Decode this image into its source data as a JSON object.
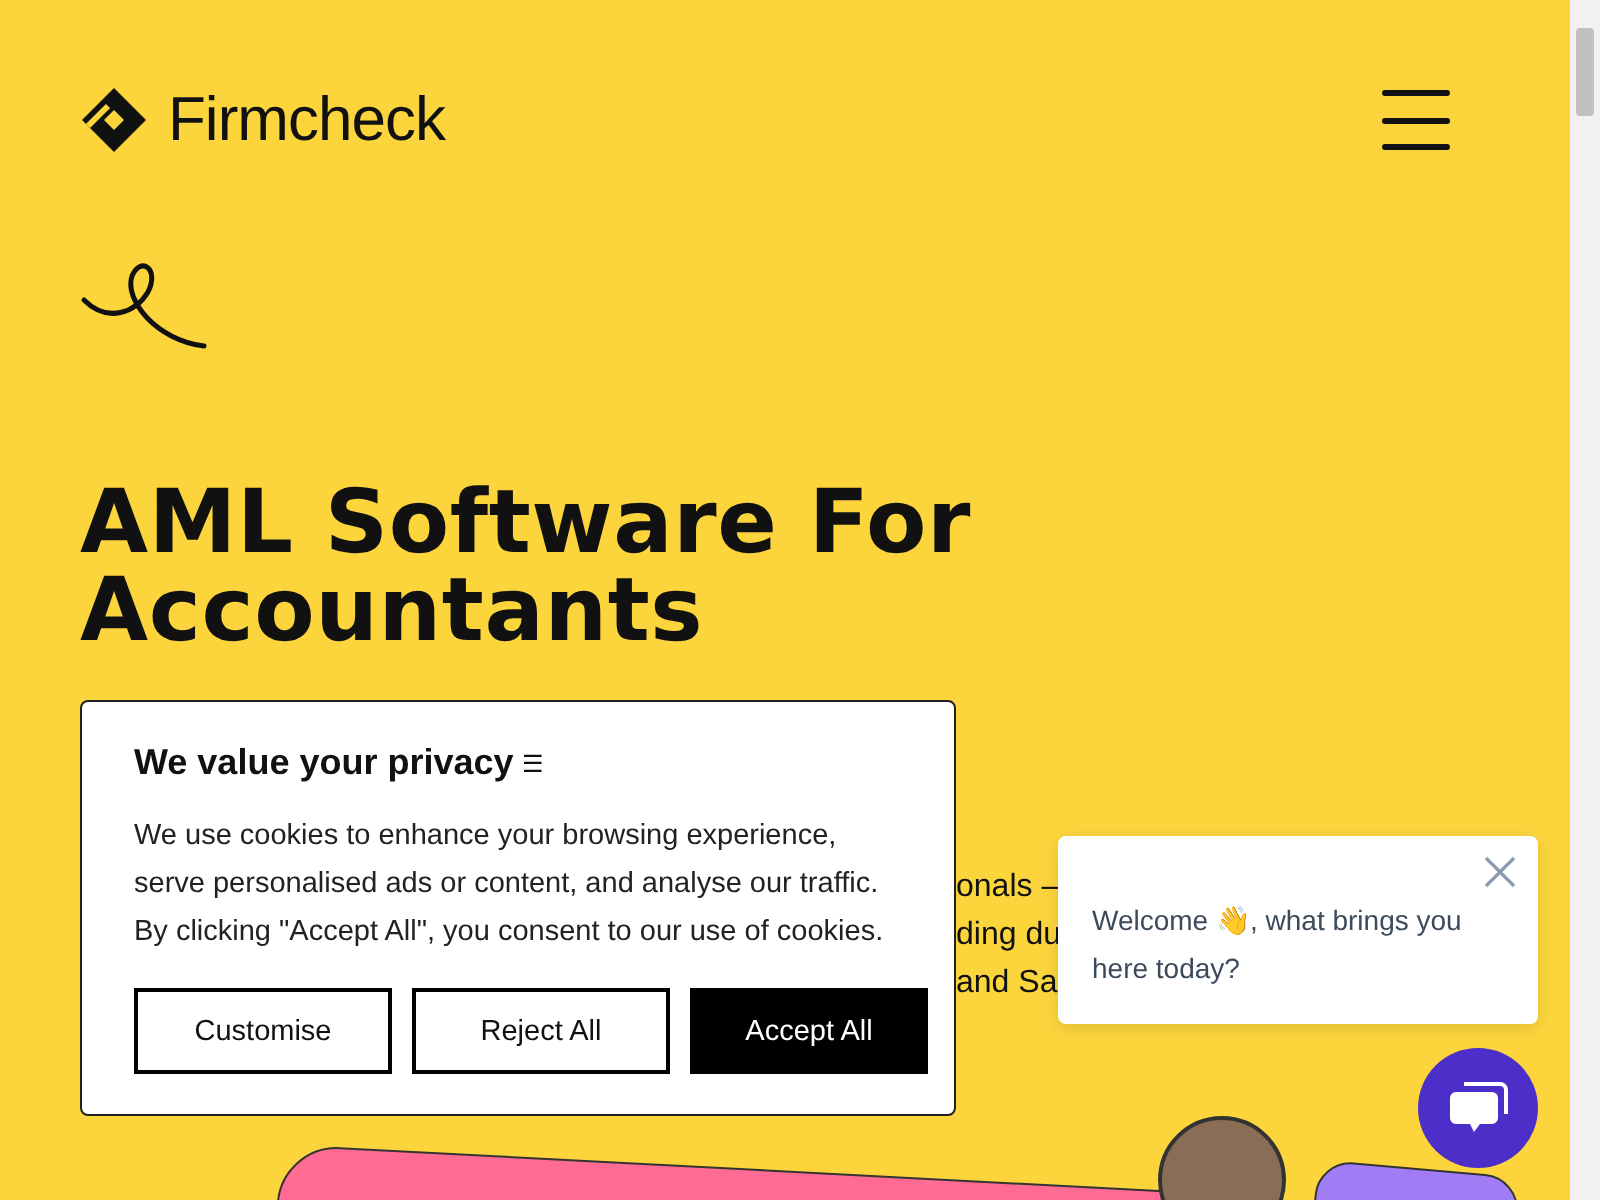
{
  "header": {
    "brand": "Firmcheck"
  },
  "hero": {
    "heading": "AML Software For Accountants",
    "text_lines": [
      "onals –",
      "ding du",
      "and Sa"
    ]
  },
  "cookie_banner": {
    "title": "We value your privacy",
    "title_glyph": "☰",
    "message": "We use cookies to enhance your browsing experience, serve personalised ads or content, and analyse our traffic. By clicking \"Accept All\", you consent to our use of cookies.",
    "buttons": [
      {
        "label": "Customise",
        "kind": "outline"
      },
      {
        "label": "Reject All",
        "kind": "outline"
      },
      {
        "label": "Accept All",
        "kind": "filled"
      }
    ]
  },
  "chat_popup": {
    "message": "Welcome 👋, what brings you here today?"
  }
}
